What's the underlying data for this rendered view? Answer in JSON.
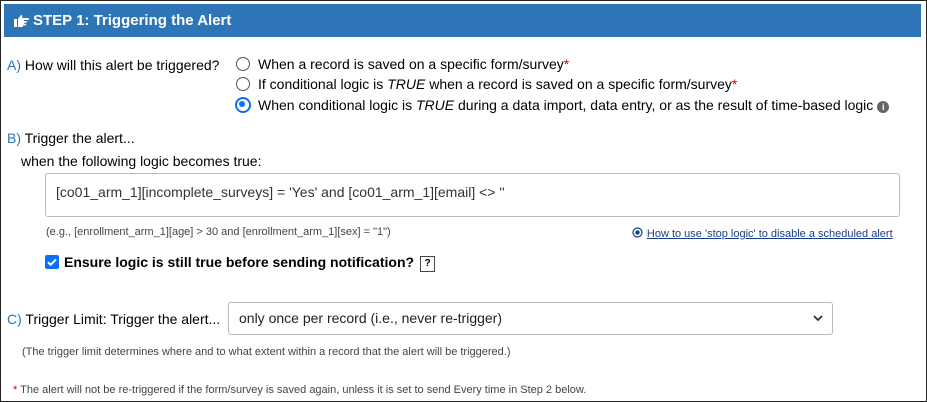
{
  "header": {
    "title": "STEP 1: Triggering the Alert",
    "icon": "hand-pointing-right-icon"
  },
  "section_a": {
    "letter": "A)",
    "question": "How will this alert be triggered?",
    "options": [
      {
        "label": "When a record is saved on a specific form/survey",
        "required_mark": "*",
        "selected": false
      },
      {
        "label_pre": "If conditional logic is ",
        "label_em": "TRUE",
        "label_post": " when a record is saved on a specific form/survey",
        "required_mark": "*",
        "selected": false
      },
      {
        "label_pre": "When conditional logic is ",
        "label_em": "TRUE",
        "label_post": " during a data import, data entry, or as the result of time-based logic",
        "selected": true,
        "info_icon": "i"
      }
    ]
  },
  "section_b": {
    "letter": "B)",
    "title": "Trigger the alert...",
    "subtitle": "when the following logic becomes true:",
    "logic_value": "[co01_arm_1][incomplete_surveys] = 'Yes' and [co01_arm_1][email] <> ''",
    "example": "(e.g., [enrollment_arm_1][age] > 30 and [enrollment_arm_1][sex] = \"1\")",
    "stop_logic_link": "How to use 'stop logic' to disable a scheduled alert",
    "ensure_label": "Ensure logic is still true before sending notification?",
    "ensure_checked": true,
    "help_mark": "?"
  },
  "section_c": {
    "letter": "C)",
    "label": "Trigger Limit: Trigger the alert...",
    "selected_value": "only once per record (i.e., never re-trigger)",
    "note": "(The trigger limit determines where and to what extent within a record that the alert will be triggered.)"
  },
  "footnote": {
    "mark": "*",
    "text": "The alert will not be re-triggered if the form/survey is saved again, unless it is set to send Every time in Step 2 below."
  },
  "colors": {
    "header_bg": "#2e75b8",
    "accent": "#0d6efd",
    "required": "#cc0000"
  }
}
